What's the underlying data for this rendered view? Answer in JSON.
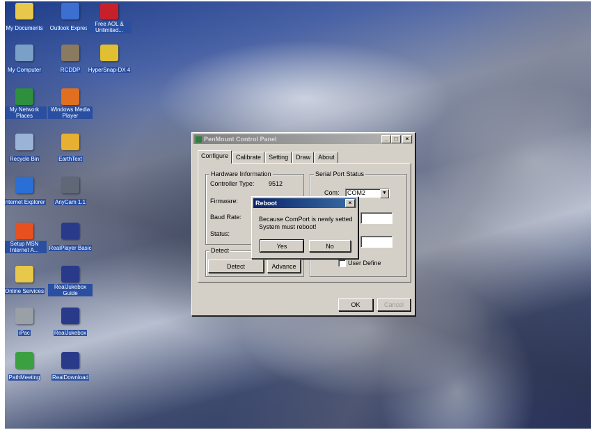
{
  "desktop_icons": [
    {
      "label": "My Documents",
      "color": "#e8c84a"
    },
    {
      "label": "Outlook Express",
      "color": "#3d6fd1"
    },
    {
      "label": "Free AOL & Unlimited...",
      "color": "#c8202a"
    },
    {
      "label": "My Computer",
      "color": "#7aa0c8"
    },
    {
      "label": "RCDDP",
      "color": "#8a7a60"
    },
    {
      "label": "HyperSnap-DX 4",
      "color": "#e0c030"
    },
    {
      "label": "My Network Places",
      "color": "#2e8f3e"
    },
    {
      "label": "Windows Media Player",
      "color": "#e07020"
    },
    {
      "label": "Recycle Bin",
      "color": "#9ab4d8"
    },
    {
      "label": "EarthText",
      "color": "#e8b030"
    },
    {
      "label": "Internet Explorer",
      "color": "#2a6fd6"
    },
    {
      "label": "AnyCam 1.1",
      "color": "#606878"
    },
    {
      "label": "Setup MSN Internet A...",
      "color": "#e85020"
    },
    {
      "label": "RealPlayer Basic",
      "color": "#2a3a8a"
    },
    {
      "label": "Online Services",
      "color": "#e8c84a"
    },
    {
      "label": "RealJukebox Guide",
      "color": "#2a3a8a"
    },
    {
      "label": "iPac",
      "color": "#9aa0a8"
    },
    {
      "label": "RealJukebox",
      "color": "#2a3a8a"
    },
    {
      "label": "PathMeeting",
      "color": "#3aa040"
    },
    {
      "label": "RealDownload",
      "color": "#2a3a8a"
    }
  ],
  "control_panel": {
    "title": "PenMount Control Panel",
    "controls": {
      "minimize": "_",
      "maximize": "□",
      "close": "×"
    },
    "tabs": [
      "Configure",
      "Calibrate",
      "Setting",
      "Draw",
      "About"
    ],
    "hardware_group": "Hardware Information",
    "controller_type_label": "Controller Type:",
    "controller_type_value": "9512",
    "firmware_label": "Firmware:",
    "baud_rate_label": "Baud Rate:",
    "status_label": "Status:",
    "detect_group": "Detect",
    "detect_button": "Detect",
    "advance_button": "Advance",
    "serial_group": "Serial Port Status",
    "com_label": "Com:",
    "com_value": "COM2",
    "user_define_label": "User Define",
    "ok_button": "OK",
    "cancel_button": "Cancel"
  },
  "reboot_dialog": {
    "title": "Reboot",
    "close": "×",
    "message_line1": "Because ComPort is newly setted",
    "message_line2": "System must reboot!",
    "yes_button": "Yes",
    "no_button": "No"
  }
}
